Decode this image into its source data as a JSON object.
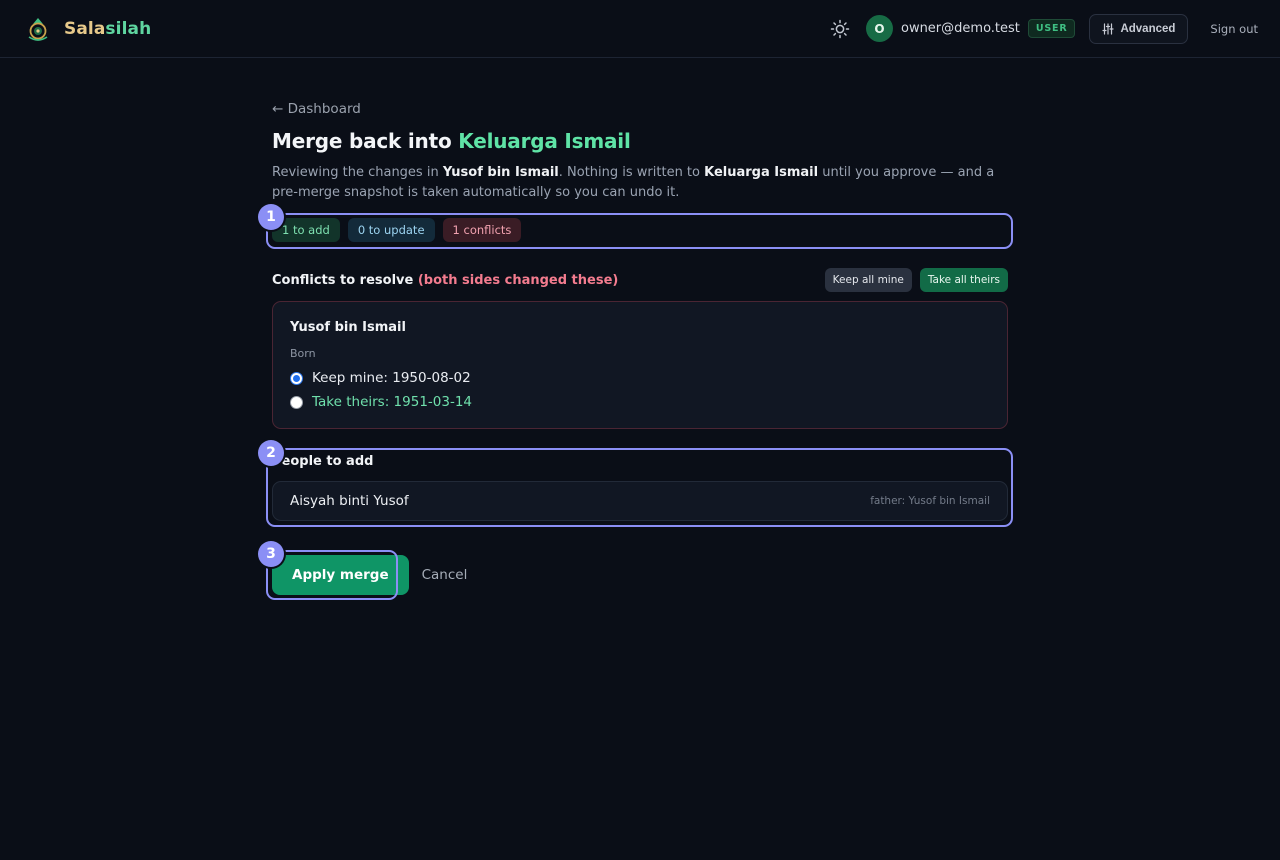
{
  "header": {
    "brand": {
      "name_part1": "Sala",
      "name_part2": "silah"
    },
    "theme_icon": "sun-icon",
    "user": {
      "avatar_letter": "O",
      "email": "owner@demo.test",
      "role": "USER"
    },
    "advanced_label": "Advanced",
    "advanced_icon": "sliders-icon",
    "signout_label": "Sign out"
  },
  "page": {
    "back_label": "← Dashboard",
    "title_prefix": "Merge back into ",
    "title_target": "Keluarga Ismail",
    "intro": {
      "part1": "Reviewing the changes in ",
      "source": "Yusof bin Ismail",
      "part2": ". Nothing is written to ",
      "target": "Keluarga Ismail",
      "part3": " until you approve — and a pre-merge snapshot is taken automatically so you can undo it."
    }
  },
  "summary": {
    "to_add": "1 to add",
    "to_update": "0 to update",
    "conflicts": "1 conflicts"
  },
  "conflicts": {
    "title": "Conflicts to resolve",
    "note": " (both sides changed these)",
    "keep_all_mine": "Keep all mine",
    "take_all_theirs": "Take all theirs",
    "items": [
      {
        "person": "Yusof bin Ismail",
        "field": "Born",
        "mine": "Keep mine: 1950-08-02",
        "theirs": "Take theirs: 1951-03-14",
        "selected": "mine"
      }
    ]
  },
  "people_to_add": {
    "title": "People to add",
    "items": [
      {
        "name": "Aisyah binti Yusof",
        "relation": "father: Yusof bin Ismail"
      }
    ]
  },
  "actions": {
    "apply": "Apply merge",
    "cancel": "Cancel"
  },
  "highlights": [
    "1",
    "2",
    "3"
  ],
  "colors": {
    "background": "#0a0e17",
    "accent_green": "#5fe3a6",
    "primary_button": "#0f9566",
    "conflict_red": "#f47c8f",
    "highlight": "#8b8ff5"
  }
}
